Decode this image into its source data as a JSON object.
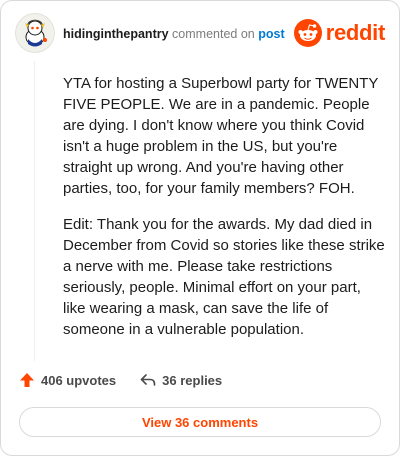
{
  "comment": {
    "author": "hidinginthepantry",
    "action_text": "commented on",
    "target_link": "post",
    "paragraphs": [
      "YTA for hosting a Superbowl party for TWENTY FIVE PEOPLE. We are in a pandemic. People are dying. I don't know where you think Covid isn't a huge problem in the US, but you're straight up wrong. And you're having other parties, too, for your family members? FOH.",
      "Edit: Thank you for the awards. My dad died in December from Covid so stories like these strike a nerve with me. Please take restrictions seriously, people. Minimal effort on your part, like wearing a mask, can save the life of someone in a vulnerable population."
    ]
  },
  "brand": {
    "name": "reddit",
    "color": "#ff4500"
  },
  "stats": {
    "upvotes": "406 upvotes",
    "replies": "36 replies"
  },
  "actions": {
    "view_comments": "View 36 comments"
  },
  "colors": {
    "accent": "#ff4500",
    "link": "#0079d3",
    "muted": "#7c7c7c",
    "border": "#d7dadc"
  },
  "icons": [
    "avatar",
    "reddit-logo-icon",
    "upvote-arrow-icon",
    "reply-arrow-icon"
  ]
}
